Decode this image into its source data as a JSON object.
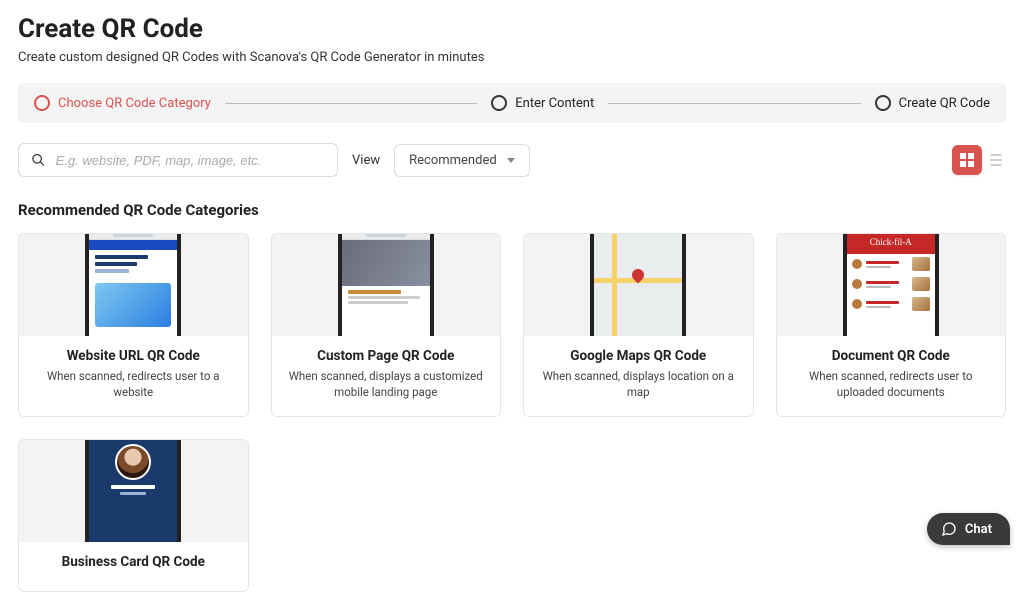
{
  "header": {
    "title": "Create QR Code",
    "subtitle": "Create custom designed QR Codes with Scanova's QR Code Generator in minutes"
  },
  "stepper": {
    "step1": "Choose QR Code Category",
    "step2": "Enter Content",
    "step3": "Create QR Code"
  },
  "search": {
    "placeholder": "E.g. website, PDF, map, image, etc."
  },
  "view": {
    "label": "View",
    "selected": "Recommended"
  },
  "section_title": "Recommended QR Code Categories",
  "cards": {
    "website": {
      "title": "Website URL QR Code",
      "desc": "When scanned, redirects user to a website"
    },
    "custom": {
      "title": "Custom Page QR Code",
      "desc": "When scanned, displays a customized mobile landing page"
    },
    "maps": {
      "title": "Google Maps QR Code",
      "desc": "When scanned, displays location on a map"
    },
    "document": {
      "title": "Document QR Code",
      "desc": "When scanned, redirects user to uploaded documents",
      "brand": "Chick-fil-A"
    },
    "bizcard": {
      "title": "Business Card QR Code"
    }
  },
  "chat": {
    "label": "Chat"
  }
}
